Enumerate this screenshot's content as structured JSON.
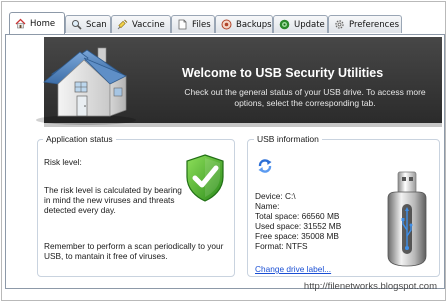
{
  "tabs": [
    {
      "label": "Home",
      "icon": "home-icon",
      "active": true
    },
    {
      "label": "Scan",
      "icon": "magnifier-icon",
      "active": false
    },
    {
      "label": "Vaccine",
      "icon": "syringe-icon",
      "active": false
    },
    {
      "label": "Files",
      "icon": "file-icon",
      "active": false
    },
    {
      "label": "Backups",
      "icon": "backup-icon",
      "active": false
    },
    {
      "label": "Update",
      "icon": "update-icon",
      "active": false
    },
    {
      "label": "Preferences",
      "icon": "gear-icon",
      "active": false
    }
  ],
  "banner": {
    "title": "Welcome to USB Security Utilities",
    "description": "Check out the general status of your USB drive. To access more options, select the corresponding tab."
  },
  "app_status": {
    "title": "Application status",
    "risk_label": "Risk level:",
    "risk_text": "The risk level is calculated by bearing in mind the new viruses and threats detected every day.",
    "reminder": "Remember to perform a scan periodically to your USB, to mantain it free of viruses."
  },
  "usb_info": {
    "title": "USB information",
    "device": "Device: C:\\",
    "name": "Name:",
    "total_space": "Total space: 66560 MB",
    "used_space": "Used space: 31552 MB",
    "free_space": "Free space: 35008 MB",
    "format": "Format: NTFS",
    "change_link": "Change drive label..."
  },
  "watermark": "http://filenetworks.blogspot.com",
  "colors": {
    "banner_bg": "#3a3a3a",
    "link": "#1a4fd4",
    "shield_green": "#4fb424",
    "refresh_blue": "#2c6fd6"
  }
}
